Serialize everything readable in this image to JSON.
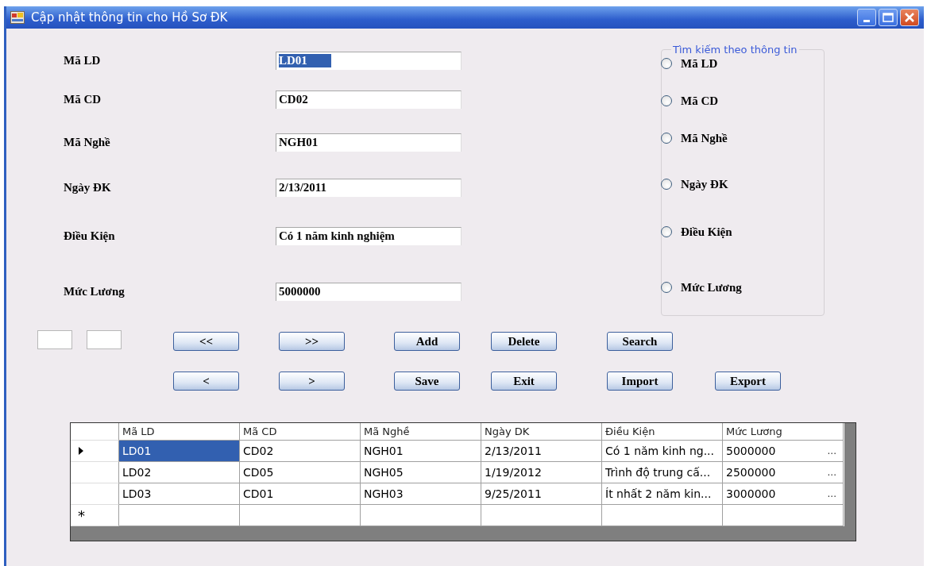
{
  "window": {
    "title": "Cập nhật thông tin cho Hồ Sơ ĐK"
  },
  "fields": [
    {
      "label": "Mã LD",
      "value": "LD01",
      "text_selected": true
    },
    {
      "label": "Mã CD",
      "value": "CD02",
      "text_selected": false
    },
    {
      "label": "Mã Nghề",
      "value": "NGH01",
      "text_selected": false
    },
    {
      "label": "Ngày ĐK",
      "value": "2/13/2011",
      "text_selected": false
    },
    {
      "label": "Điều Kiện",
      "value": "Có 1 năm kinh nghiệm",
      "text_selected": false
    },
    {
      "label": "Mức Lương",
      "value": "5000000",
      "text_selected": false
    }
  ],
  "search_group": {
    "title": "Tìm kiếm theo thông tin",
    "options": [
      {
        "label": "Mã LD",
        "selected": false
      },
      {
        "label": "Mã CD",
        "selected": false
      },
      {
        "label": "Mã Nghề",
        "selected": false
      },
      {
        "label": "Ngày ĐK",
        "selected": false
      },
      {
        "label": "Điều Kiện",
        "selected": false
      },
      {
        "label": "Mức Lương",
        "selected": false
      }
    ]
  },
  "button_rows": [
    [
      "<<",
      ">>",
      "Add",
      "Delete",
      "Search"
    ],
    [
      "<",
      ">",
      "Save",
      "Exit",
      "Import",
      "Export"
    ]
  ],
  "table": {
    "columns": [
      "Mã LD",
      "Mã CD",
      "Mã Nghề",
      "Ngày DK",
      "Điều Kiện",
      "Mức Lương"
    ],
    "rows": [
      {
        "selected": true,
        "cells": [
          "LD01",
          "CD02",
          "NGH01",
          "2/13/2011",
          "Có 1 năm kinh ng...",
          "5000000"
        ],
        "more": "..."
      },
      {
        "selected": false,
        "cells": [
          "LD02",
          "CD05",
          "NGH05",
          "1/19/2012",
          "Trình độ trung cấ...",
          "2500000"
        ],
        "more": "..."
      },
      {
        "selected": false,
        "cells": [
          "LD03",
          "CD01",
          "NGH03",
          "9/25/2011",
          "Ít nhất 2 năm kin...",
          "3000000"
        ],
        "more": "..."
      }
    ],
    "new_row_marker": "*"
  }
}
